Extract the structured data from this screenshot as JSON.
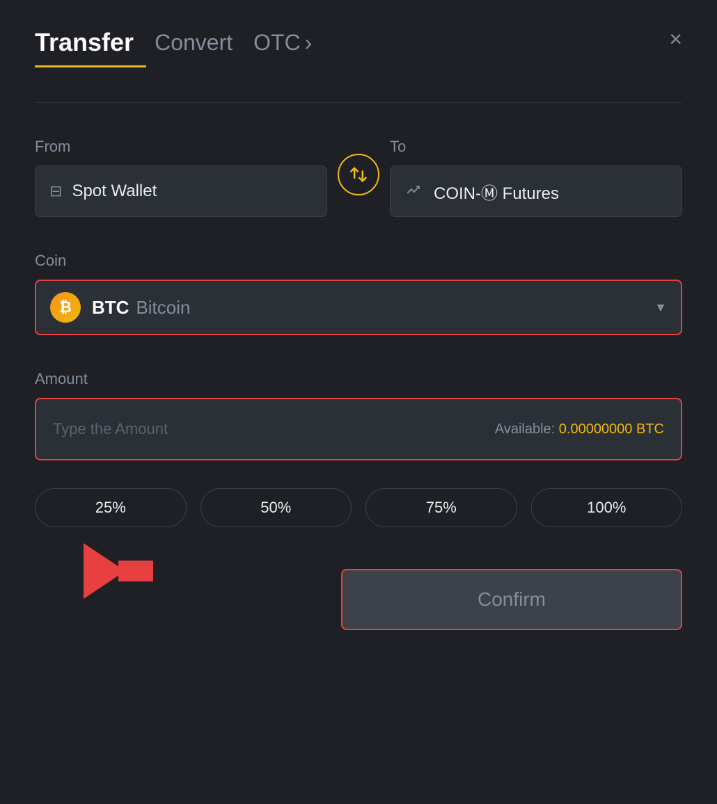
{
  "header": {
    "tab_transfer": "Transfer",
    "tab_convert": "Convert",
    "tab_otc": "OTC",
    "close_label": "×"
  },
  "from": {
    "label": "From",
    "wallet_name": "Spot Wallet"
  },
  "to": {
    "label": "To",
    "wallet_name": "COIN-Ⓜ Futures"
  },
  "coin": {
    "label": "Coin",
    "symbol": "BTC",
    "name": "Bitcoin"
  },
  "amount": {
    "label": "Amount",
    "placeholder": "Type the Amount",
    "available_label": "Available:",
    "available_value": "0.00000000 BTC"
  },
  "percentages": [
    "25%",
    "50%",
    "75%",
    "100%"
  ],
  "confirm_button": "Confirm"
}
